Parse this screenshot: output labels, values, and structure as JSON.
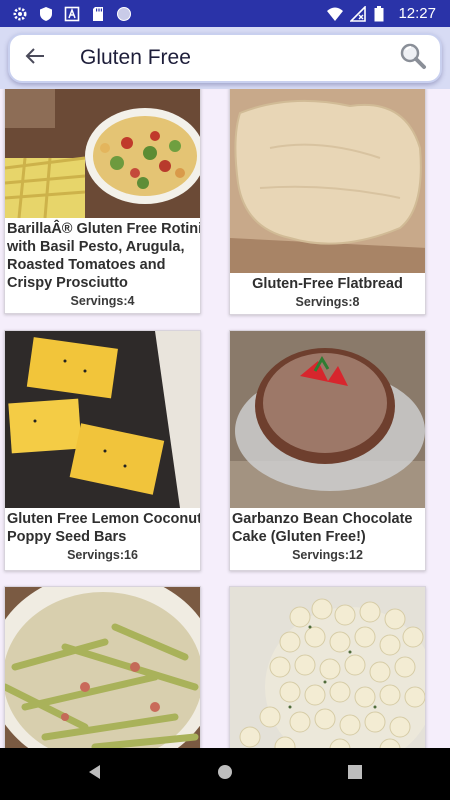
{
  "status_bar": {
    "time": "12:27",
    "left_icons": [
      "settings-icon",
      "shield-icon",
      "a-box-icon",
      "sd-card-icon",
      "circle-icon"
    ],
    "right_icons": [
      "wifi-icon",
      "no-signal-icon",
      "battery-icon"
    ]
  },
  "search": {
    "query": "Gluten Free",
    "back_icon": "arrow-left-icon",
    "search_icon": "magnifier-icon"
  },
  "recipes": [
    {
      "title_lines": [
        "BarillaÂ® Gluten Free Rotini",
        "with Basil Pesto, Arugula,",
        "Roasted Tomatoes and",
        "Crispy Prosciutto"
      ],
      "servings": "Servings:4"
    },
    {
      "title_lines": [
        "Gluten-Free Flatbread"
      ],
      "servings": "Servings:8"
    },
    {
      "title_lines": [
        "Gluten Free Lemon Coconut",
        "Poppy Seed Bars"
      ],
      "servings": "Servings:16"
    },
    {
      "title_lines": [
        "Garbanzo Bean Chocolate",
        "Cake (Gluten Free!)"
      ],
      "servings": "Servings:12"
    },
    {
      "title_lines": [],
      "servings": ""
    },
    {
      "title_lines": [],
      "servings": ""
    }
  ],
  "nav": {
    "icons": [
      "back-triangle-icon",
      "home-circle-icon",
      "recents-square-icon"
    ]
  }
}
